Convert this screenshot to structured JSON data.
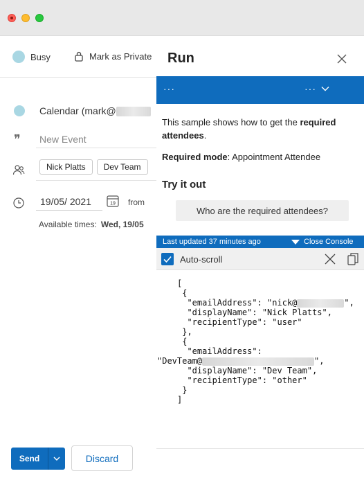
{
  "compose": {
    "status_label": "Busy",
    "private_label": "Mark as Private",
    "calendar_label": "Calendar (mark@",
    "title_placeholder": "New Event",
    "attendees": [
      "Nick Platts",
      "Dev Team"
    ],
    "date_value": "19/05/ 2021",
    "calendar_day": "19",
    "from_label": "from",
    "available_label": "Available times:",
    "available_value": "Wed, 19/05",
    "send_label": "Send",
    "discard_label": "Discard"
  },
  "run_pane": {
    "title": "Run",
    "header_menu_left": "···",
    "header_menu_right": "···",
    "description_prefix": "This sample shows how to get the ",
    "description_bold": "required attendees",
    "description_suffix": ".",
    "mode_label": "Required mode",
    "mode_value": ": Appointment Attendee",
    "try_it_label": "Try it out",
    "action_button": "Who are the required attendees?",
    "last_updated": "Last updated 37 minutes ago",
    "close_console": "Close Console",
    "autoscroll_label": "Auto-scroll",
    "console_lines": [
      "[",
      " {",
      "  \"emailAddress\": \"nick@",
      "  \"displayName\": \"Nick Platts\",",
      "  \"recipientType\": \"user\"",
      " },",
      " {",
      "  \"emailAddress\":",
      "\"DevTeam@",
      "  \"displayName\": \"Dev Team\",",
      "  \"recipientType\": \"other\"",
      " }",
      "]"
    ]
  },
  "colors": {
    "accent": "#0f6cbd",
    "busy_dot": "#a9d7e3"
  },
  "icons": [
    "close-icon",
    "lock-icon",
    "quote-icon",
    "people-icon",
    "clock-icon",
    "calendar-icon",
    "chevron-down-icon",
    "checkbox-icon",
    "clear-icon",
    "copy-icon"
  ]
}
